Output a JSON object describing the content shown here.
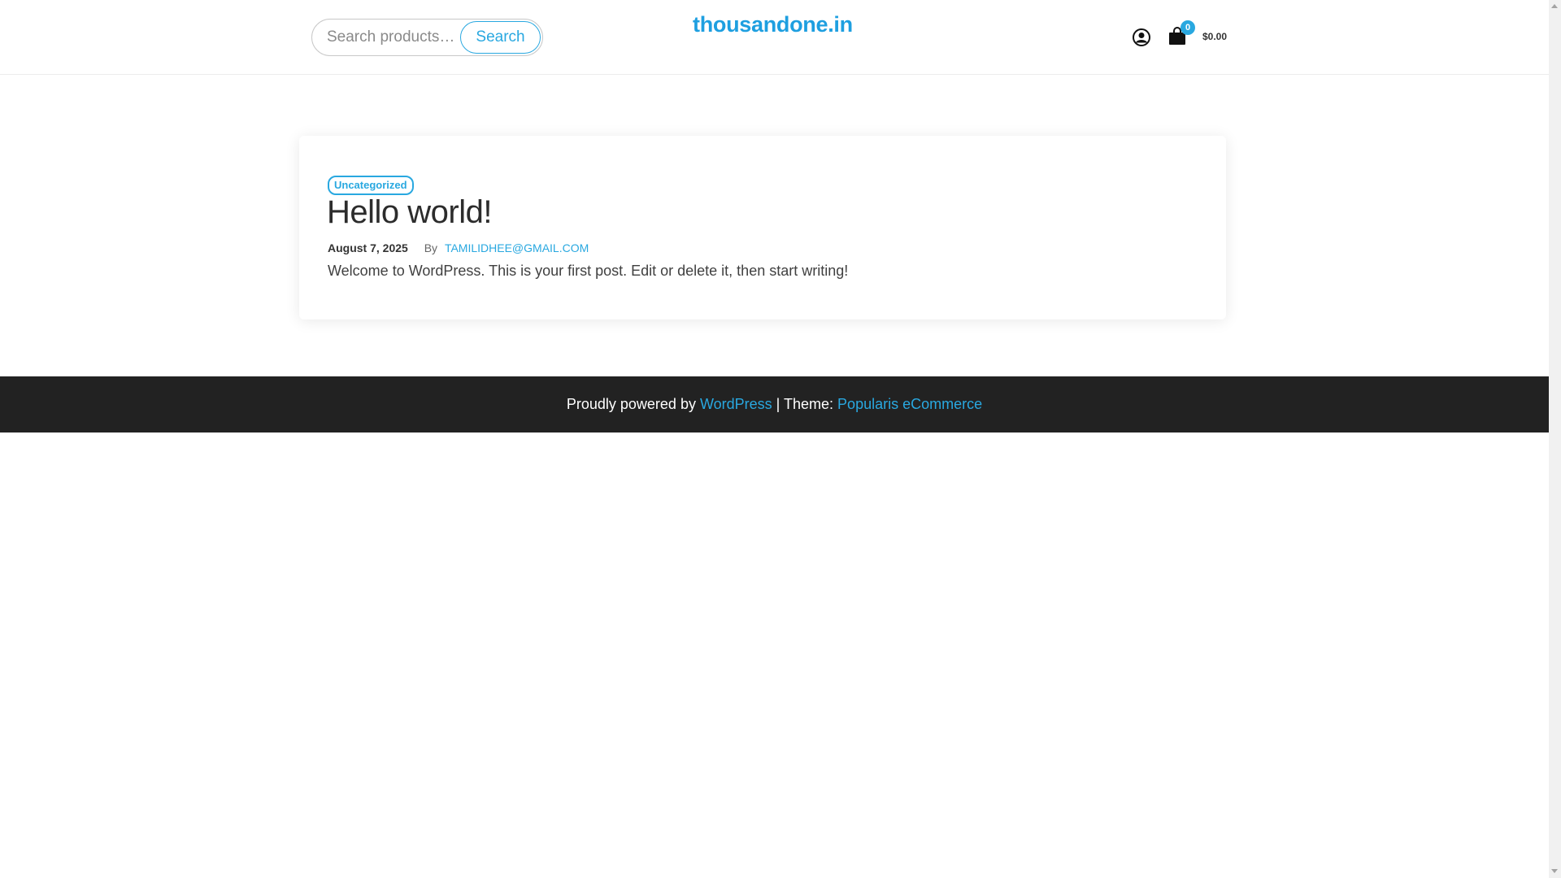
{
  "header": {
    "search_placeholder": "Search products…",
    "search_button": "Search",
    "site_title": "thousandone.in",
    "account_icon": "user-circle-icon",
    "cart_icon": "shopping-bag-icon",
    "cart_count": "0",
    "cart_total": "$0.00"
  },
  "post": {
    "category": "Uncategorized",
    "title": "Hello world!",
    "date": "August 7, 2025",
    "by_label": "By",
    "author": "TAMILIDHEE@GMAIL.COM",
    "excerpt": "Welcome to WordPress. This is your first post. Edit or delete it, then start writing!"
  },
  "footer": {
    "prefix": "Proudly powered by ",
    "wordpress_link": "WordPress",
    "separator": " | Theme: ",
    "theme_link": "Popularis eCommerce"
  },
  "colors": {
    "accent": "#29a8e0",
    "title": "#1e9fe0",
    "footer_bg": "#222222"
  }
}
